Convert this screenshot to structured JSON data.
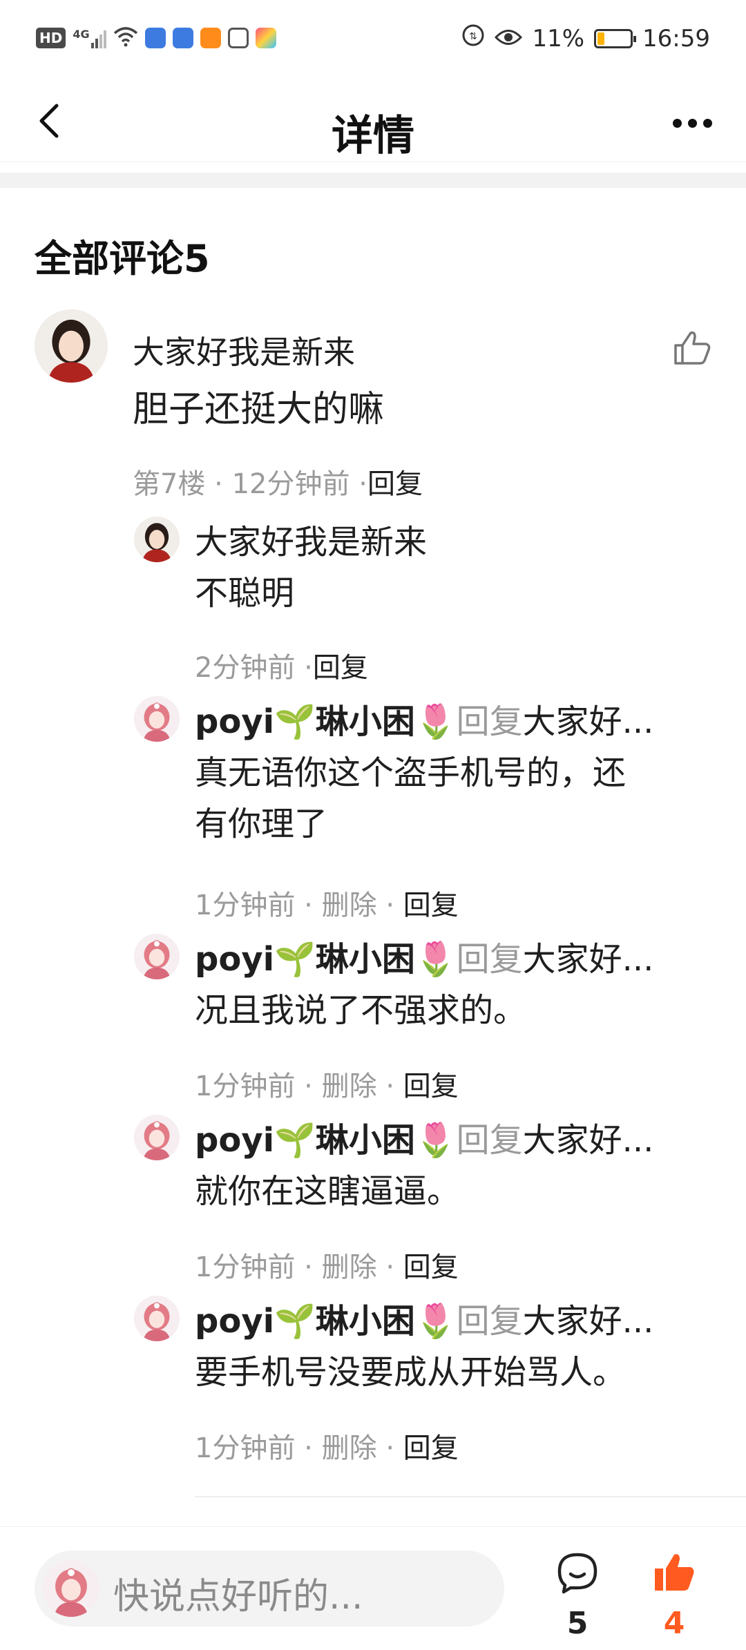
{
  "status_bar": {
    "network": "4G",
    "battery": "11%",
    "time": "16:59"
  },
  "header": {
    "title": "详情"
  },
  "comments_section": {
    "title": "全部评论5"
  },
  "main_comment": {
    "name": "大家好我是新来",
    "text": "胆子还挺大的嘛",
    "floor": "第7楼",
    "time": "12分钟前",
    "reply_label": "回复"
  },
  "replies": [
    {
      "name": "大家好我是新来",
      "line1": "不聪明",
      "line2": "",
      "time": "2分钟前",
      "reply_label": "回复"
    },
    {
      "name": "poyi🌱琳小困🌷",
      "reply_to_word": "回复",
      "target": "大家好...",
      "line1": "真无语你这个盗手机号的，还",
      "line2": "有你理了",
      "time": "1分钟前",
      "delete_label": "删除",
      "reply_label": "回复"
    },
    {
      "name": "poyi🌱琳小困🌷",
      "reply_to_word": "回复",
      "target": "大家好...",
      "line1": "况且我说了不强求的。",
      "time": "1分钟前",
      "delete_label": "删除",
      "reply_label": "回复"
    },
    {
      "name": "poyi🌱琳小困🌷",
      "reply_to_word": "回复",
      "target": "大家好...",
      "line1": "就你在这瞎逼逼。",
      "time": "1分钟前",
      "delete_label": "删除",
      "reply_label": "回复"
    },
    {
      "name": "poyi🌱琳小困🌷",
      "reply_to_word": "回复",
      "target": "大家好...",
      "line1": "要手机号没要成从开始骂人。",
      "time": "1分钟前",
      "delete_label": "删除",
      "reply_label": "回复"
    }
  ],
  "bottom_bar": {
    "placeholder": "快说点好听的...",
    "comment_count": "5",
    "like_count": "4"
  },
  "colors": {
    "accent_orange": "#ff5a1f",
    "meta_gray": "#9a9a9a"
  },
  "icons": [
    "back-arrow-icon",
    "more-dots-icon",
    "thumb-up-outline-icon",
    "comment-bubble-icon",
    "thumb-up-filled-icon"
  ]
}
